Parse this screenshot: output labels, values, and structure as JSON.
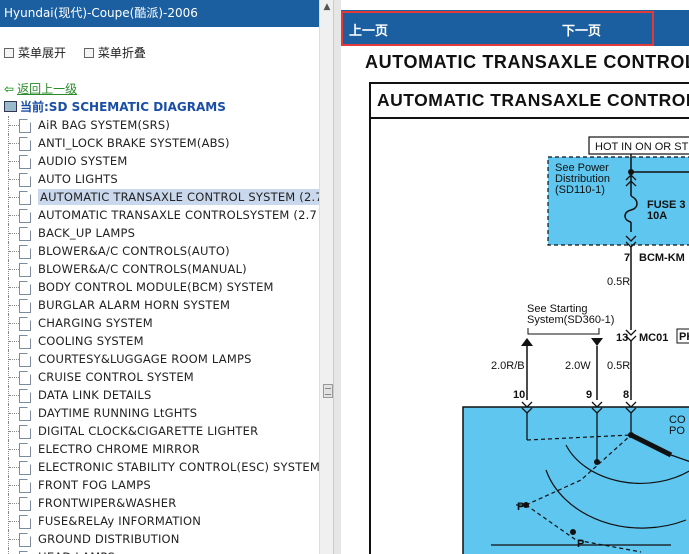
{
  "left_panel": {
    "title": "Hyundai(现代)-Coupe(酷派)-2006",
    "expand_label": "菜单展开",
    "collapse_label": "菜单折叠",
    "back_label": "返回上一级",
    "current_label": "当前:SD SCHEMATIC DIAGRAMS",
    "items": [
      {
        "label": "AiR BAG SYSTEM(SRS)"
      },
      {
        "label": "ANTI_LOCK BRAKE SYSTEM(ABS)"
      },
      {
        "label": "AUDIO SYSTEM"
      },
      {
        "label": "AUTO LIGHTS"
      },
      {
        "label": "AUTOMATIC TRANSAXLE CONTROL SYSTEM (2.7"
      },
      {
        "label": "AUTOMATIC TRANSAXLE CONTROLSYSTEM (2.7"
      },
      {
        "label": "BACK_UP LAMPS"
      },
      {
        "label": "BLOWER&A/C CONTROLS(AUTO)"
      },
      {
        "label": "BLOWER&A/C CONTROLS(MANUAL)"
      },
      {
        "label": "BODY CONTROL MODULE(BCM) SYSTEM"
      },
      {
        "label": "BURGLAR ALARM HORN SYSTEM"
      },
      {
        "label": "CHARGING SYSTEM"
      },
      {
        "label": "COOLING SYSTEM"
      },
      {
        "label": "COURTESY&LUGGAGE ROOM LAMPS"
      },
      {
        "label": "CRUISE CONTROL SYSTEM"
      },
      {
        "label": "DATA LINK DETAILS"
      },
      {
        "label": "DAYTIME RUNNING LtGHTS"
      },
      {
        "label": "DIGITAL CLOCK&CIGARETTE LIGHTER"
      },
      {
        "label": "ELECTRO CHROME MIRROR"
      },
      {
        "label": "ELECTRONIC STABILITY CONTROL(ESC) SYSTEM"
      },
      {
        "label": "FRONT FOG LAMPS"
      },
      {
        "label": "FRONTWIPER&WASHER"
      },
      {
        "label": "FUSE&RELAy INFORMATION"
      },
      {
        "label": "GROUND DISTRIBUTION"
      },
      {
        "label": "HEAD LAMPS"
      }
    ],
    "selected_index": 4
  },
  "nav": {
    "prev_label": "上一页",
    "next_label": "下一页"
  },
  "document": {
    "page_title": "AUTOMATIC TRANSAXLE CONTROL SYSTEM",
    "frame_title": "AUTOMATIC TRANSAXLE CONTROL SYSTEM",
    "diagram": {
      "hot_label": "HOT IN ON OR ST",
      "see_power_1": "See Power",
      "see_power_2": "Distribution",
      "see_power_3": "(SD110-1)",
      "fuse_1": "FUSE 3",
      "fuse_2": "10A",
      "pin7": "7",
      "bcm": "BCM-KM",
      "wire_05r_a": "0.5R",
      "see_start_1": "See Starting",
      "see_start_2": "System(SD360-1)",
      "pin13": "13",
      "mc01": "MC01",
      "ph": "PH",
      "wire_20rb": "2.0R/B",
      "wire_20w": "2.0W",
      "wire_05r_b": "0.5R",
      "pin10": "10",
      "pin9": "9",
      "pin8": "8",
      "co": "CO",
      "po": "PO",
      "p1": "P",
      "p2": "P"
    }
  },
  "colors": {
    "header_blue": "#1b5fa0",
    "highlight_red": "#e23a3a",
    "diagram_fill": "#5ec6ef",
    "selected_bg": "#c9d8ec"
  }
}
